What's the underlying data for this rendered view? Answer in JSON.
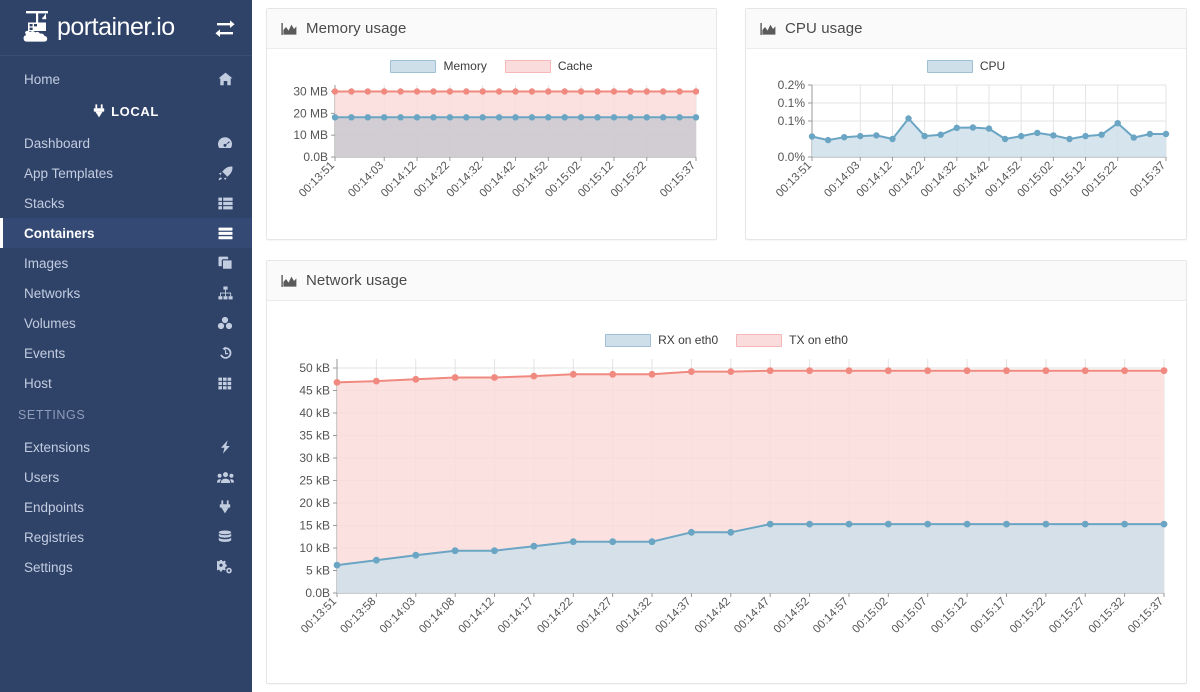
{
  "sidebar": {
    "brand": {
      "text": "portainer.io",
      "logo_icon": "portainer-whale-crane-logo",
      "toggle_icon": "exchange-arrows-icon"
    },
    "items": [
      {
        "label": "Home",
        "icon": "home-icon",
        "active": false,
        "type": "item"
      },
      {
        "label": "LOCAL",
        "icon": "plug-icon",
        "active": false,
        "type": "group-title"
      },
      {
        "label": "Dashboard",
        "icon": "tachometer-icon",
        "active": false,
        "type": "item"
      },
      {
        "label": "App Templates",
        "icon": "rocket-icon",
        "active": false,
        "type": "item"
      },
      {
        "label": "Stacks",
        "icon": "th-list-icon",
        "active": false,
        "type": "item"
      },
      {
        "label": "Containers",
        "icon": "server-stack-icon",
        "active": true,
        "type": "item"
      },
      {
        "label": "Images",
        "icon": "clone-icon",
        "active": false,
        "type": "item"
      },
      {
        "label": "Networks",
        "icon": "sitemap-icon",
        "active": false,
        "type": "item"
      },
      {
        "label": "Volumes",
        "icon": "cubes-icon",
        "active": false,
        "type": "item"
      },
      {
        "label": "Events",
        "icon": "history-icon",
        "active": false,
        "type": "item"
      },
      {
        "label": "Host",
        "icon": "th-grid-icon",
        "active": false,
        "type": "item"
      },
      {
        "label": "SETTINGS",
        "icon": "",
        "active": false,
        "type": "section"
      },
      {
        "label": "Extensions",
        "icon": "bolt-icon",
        "active": false,
        "type": "item"
      },
      {
        "label": "Users",
        "icon": "users-icon",
        "active": false,
        "type": "item"
      },
      {
        "label": "Endpoints",
        "icon": "plug-icon",
        "active": false,
        "type": "item"
      },
      {
        "label": "Registries",
        "icon": "database-icon",
        "active": false,
        "type": "item"
      },
      {
        "label": "Settings",
        "icon": "cogs-icon",
        "active": false,
        "type": "item"
      }
    ]
  },
  "panels": {
    "memory": {
      "title": "Memory usage",
      "icon": "area-chart-icon"
    },
    "cpu": {
      "title": "CPU usage",
      "icon": "area-chart-icon"
    },
    "network": {
      "title": "Network usage",
      "icon": "area-chart-icon"
    }
  },
  "colors": {
    "sidebar_bg": "#2f4268",
    "sidebar_active_bg": "#344a75",
    "blue_line": "#6aa5c4",
    "blue_fill": "#cfdfea",
    "red_line": "#f08a80",
    "red_fill": "#fbdcdc",
    "gray_fill": "#c9c9d0",
    "grid": "#e3e3e3"
  },
  "chart_data": [
    {
      "id": "memory",
      "type": "area",
      "title": "Memory usage",
      "xlabel": "",
      "ylabel": "",
      "grid": true,
      "legend_position": "top-center",
      "ylim": [
        0,
        33
      ],
      "ytick_labels": [
        "30 MB",
        "20 MB",
        "10 MB",
        "0.0B"
      ],
      "ytick_values": [
        30,
        20,
        10,
        0
      ],
      "xtick_labels": [
        "00:13:51",
        "00:14:03",
        "00:14:12",
        "00:14:22",
        "00:14:32",
        "00:14:42",
        "00:14:52",
        "00:15:02",
        "00:15:12",
        "00:15:22",
        "00:15:37"
      ],
      "x": [
        "00:13:51",
        "00:13:56",
        "00:14:01",
        "00:14:03",
        "00:14:07",
        "00:14:12",
        "00:14:17",
        "00:14:22",
        "00:14:27",
        "00:14:32",
        "00:14:37",
        "00:14:42",
        "00:14:47",
        "00:14:52",
        "00:14:57",
        "00:15:02",
        "00:15:07",
        "00:15:12",
        "00:15:17",
        "00:15:22",
        "00:15:27",
        "00:15:32",
        "00:15:37"
      ],
      "series": [
        {
          "name": "Cache",
          "color": "#f08a80",
          "fill": "#fbdcdc",
          "values": [
            30,
            30,
            30,
            30,
            30,
            30,
            30,
            30,
            30,
            30,
            30,
            30,
            30,
            30,
            30,
            30,
            30,
            30,
            30,
            30,
            30,
            30,
            30
          ]
        },
        {
          "name": "Memory",
          "color": "#6aa5c4",
          "fill": "#c9c9d0",
          "values": [
            18.2,
            18.2,
            18.2,
            18.2,
            18.2,
            18.2,
            18.2,
            18.2,
            18.2,
            18.2,
            18.2,
            18.2,
            18.2,
            18.2,
            18.2,
            18.2,
            18.2,
            18.2,
            18.2,
            18.2,
            18.2,
            18.2,
            18.2
          ]
        }
      ]
    },
    {
      "id": "cpu",
      "type": "area",
      "title": "CPU usage",
      "xlabel": "",
      "ylabel": "",
      "grid": true,
      "legend_position": "top-center",
      "ylim": [
        0,
        0.2
      ],
      "ytick_labels": [
        "0.2%",
        "0.1%",
        "0.1%",
        "0.0%"
      ],
      "ytick_values": [
        0.2,
        0.15,
        0.1,
        0.0
      ],
      "xtick_labels": [
        "00:13:51",
        "00:14:03",
        "00:14:12",
        "00:14:22",
        "00:14:32",
        "00:14:42",
        "00:14:52",
        "00:15:02",
        "00:15:12",
        "00:15:22",
        "00:15:37"
      ],
      "x": [
        "00:13:51",
        "00:13:56",
        "00:14:01",
        "00:14:03",
        "00:14:07",
        "00:14:12",
        "00:14:17",
        "00:14:22",
        "00:14:27",
        "00:14:32",
        "00:14:37",
        "00:14:42",
        "00:14:47",
        "00:14:52",
        "00:14:57",
        "00:15:02",
        "00:15:07",
        "00:15:12",
        "00:15:17",
        "00:15:22",
        "00:15:27",
        "00:15:32",
        "00:15:37"
      ],
      "series": [
        {
          "name": "CPU",
          "color": "#6aa5c4",
          "fill": "#cfdfea",
          "values": [
            0.057,
            0.047,
            0.055,
            0.058,
            0.06,
            0.05,
            0.107,
            0.058,
            0.062,
            0.081,
            0.082,
            0.079,
            0.05,
            0.058,
            0.067,
            0.06,
            0.05,
            0.058,
            0.062,
            0.094,
            0.054,
            0.064,
            0.064
          ]
        }
      ]
    },
    {
      "id": "network",
      "type": "area",
      "title": "Network usage",
      "xlabel": "",
      "ylabel": "",
      "grid": true,
      "legend_position": "top-center",
      "ylim": [
        0,
        52
      ],
      "ytick_labels": [
        "50 kB",
        "45 kB",
        "40 kB",
        "35 kB",
        "30 kB",
        "25 kB",
        "20 kB",
        "15 kB",
        "10 kB",
        "5 kB",
        "0.0B"
      ],
      "ytick_values": [
        50,
        45,
        40,
        35,
        30,
        25,
        20,
        15,
        10,
        5,
        0
      ],
      "xtick_labels": [
        "00:13:51",
        "00:13:58",
        "00:14:03",
        "00:14:08",
        "00:14:12",
        "00:14:17",
        "00:14:22",
        "00:14:27",
        "00:14:32",
        "00:14:37",
        "00:14:42",
        "00:14:47",
        "00:14:52",
        "00:14:57",
        "00:15:02",
        "00:15:07",
        "00:15:12",
        "00:15:17",
        "00:15:22",
        "00:15:27",
        "00:15:32",
        "00:15:37"
      ],
      "x": [
        "00:13:51",
        "00:13:58",
        "00:14:03",
        "00:14:08",
        "00:14:12",
        "00:14:17",
        "00:14:22",
        "00:14:27",
        "00:14:32",
        "00:14:37",
        "00:14:42",
        "00:14:47",
        "00:14:52",
        "00:14:57",
        "00:15:02",
        "00:15:07",
        "00:15:12",
        "00:15:17",
        "00:15:22",
        "00:15:27",
        "00:15:32",
        "00:15:37"
      ],
      "series": [
        {
          "name": "TX on eth0",
          "color": "#f08a80",
          "fill": "#fbdcdc",
          "values": [
            46.8,
            47.1,
            47.5,
            47.9,
            47.9,
            48.2,
            48.6,
            48.6,
            48.6,
            49.2,
            49.2,
            49.4,
            49.4,
            49.4,
            49.4,
            49.4,
            49.4,
            49.4,
            49.4,
            49.4,
            49.4,
            49.4
          ]
        },
        {
          "name": "RX on eth0",
          "color": "#6aa5c4",
          "fill": "#cfdfea",
          "values": [
            6.2,
            7.3,
            8.4,
            9.4,
            9.4,
            10.4,
            11.4,
            11.4,
            11.4,
            13.5,
            13.5,
            15.3,
            15.3,
            15.3,
            15.3,
            15.3,
            15.3,
            15.3,
            15.3,
            15.3,
            15.3,
            15.3
          ]
        }
      ]
    }
  ]
}
